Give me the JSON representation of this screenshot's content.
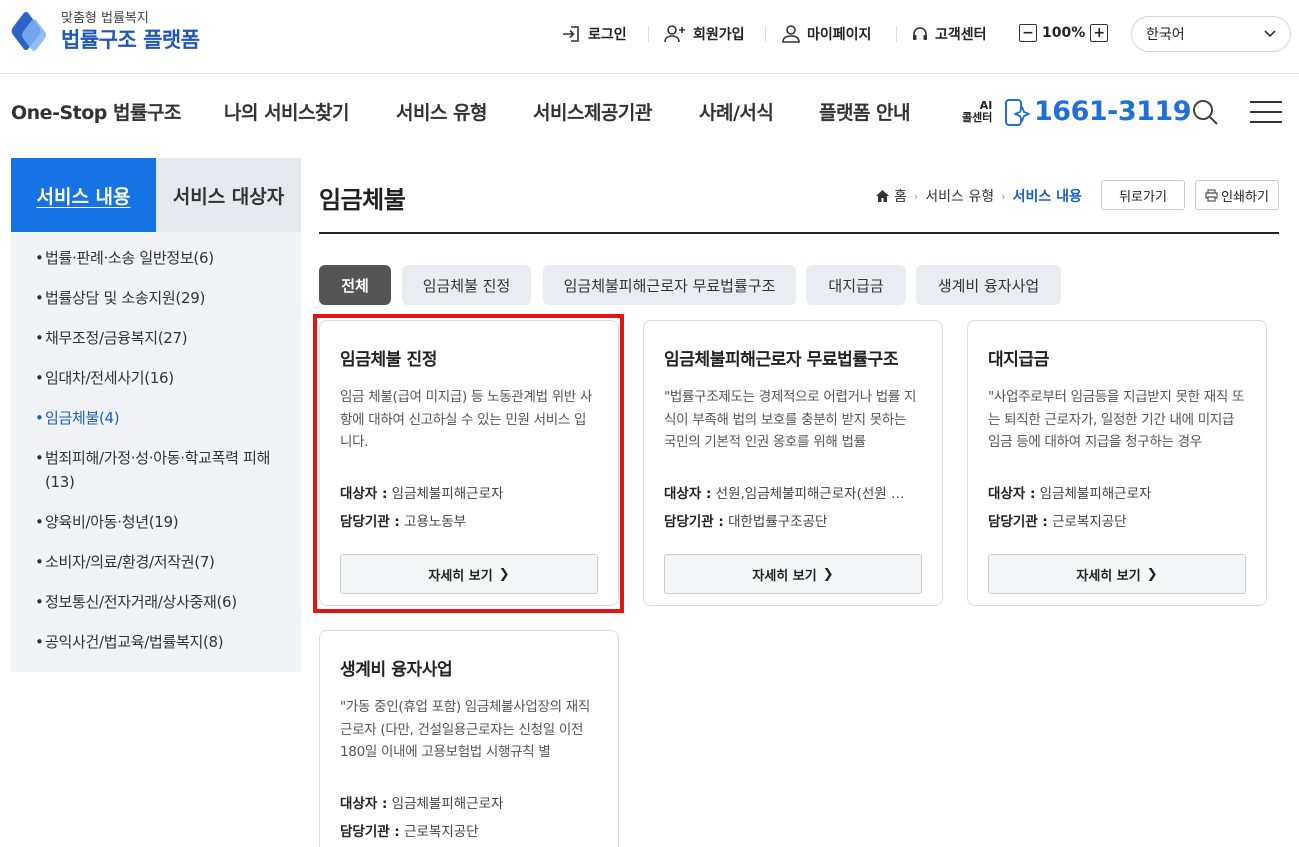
{
  "header": {
    "logo_small": "맞춤형 법률복지",
    "logo_big": "법률구조 플랫폼",
    "login": "로그인",
    "signup": "회원가입",
    "mypage": "마이페이지",
    "support": "고객센터",
    "zoom_minus": "−",
    "zoom_value": "100%",
    "zoom_plus": "+",
    "language": "한국어"
  },
  "nav": {
    "items": [
      "One-Stop 법률구조",
      "나의 서비스찾기",
      "서비스 유형",
      "서비스제공기관",
      "사례/서식",
      "플랫폼 안내"
    ],
    "ai_line1": "AI",
    "ai_line2": "콜센터",
    "phone": "1661-3119"
  },
  "sidebar": {
    "tabs": [
      "서비스 내용",
      "서비스 대상자"
    ],
    "items": [
      "법률·판례·소송 일반정보(6)",
      "법률상담 및 소송지원(29)",
      "채무조정/금융복지(27)",
      "임대차/전세사기(16)",
      "임금체불(4)",
      "범죄피해/가정·성·아동·학교폭력 피해(13)",
      "양육비/아동·청년(19)",
      "소비자/의료/환경/저작권(7)",
      "정보통신/전자거래/상사중재(6)",
      "공익사건/법교육/법률복지(8)"
    ]
  },
  "content": {
    "title": "임금체불",
    "breadcrumb": [
      "홈",
      "서비스 유형",
      "서비스 내용"
    ],
    "back_button": "뒤로가기",
    "print_button": "인쇄하기",
    "filters": [
      "전체",
      "임금체불 진정",
      "임금체불피해근로자 무료법률구조",
      "대지급금",
      "생계비 융자사업"
    ],
    "target_label": "대상자 :",
    "agency_label": "담당기관 :",
    "more_label": "자세히 보기",
    "cards": [
      {
        "title": "임금체불 진정",
        "desc": "임금 체불(급여 미지급) 등 노동관계법 위반 사항에 대하여 신고하실 수 있는 민원 서비스 입니다.",
        "target": "임금체불피해근로자",
        "agency": "고용노동부"
      },
      {
        "title": "임금체불피해근로자 무료법률구조",
        "desc": "\"법률구조제도는 경제적으로 어렵거나 법률 지식이 부족해 법의 보호를 충분히 받지 못하는 국민의 기본적 인권 옹호를 위해 법률",
        "target": "선원,임금체불피해근로자(선원 …",
        "agency": "대한법률구조공단"
      },
      {
        "title": "대지급금",
        "desc": "\"사업주로부터 임금등을 지급받지 못한 재직 또는 퇴직한 근로자가, 일정한 기간 내에 미지급임금 등에 대하여 지급을 청구하는 경우",
        "target": "임금체불피해근로자",
        "agency": "근로복지공단"
      },
      {
        "title": "생계비 융자사업",
        "desc": "\"가동 중인(휴업 포함) 임금체불사업장의 재직근로자 (다만, 건설일용근로자는 신청일 이전 180일 이내에 고용보험법 시행규칙 별",
        "target": "임금체불피해근로자",
        "agency": "근로복지공단"
      }
    ]
  },
  "colors": {
    "primary": "#1673e6",
    "phone": "#1f6fd6",
    "highlight": "#e31414"
  }
}
